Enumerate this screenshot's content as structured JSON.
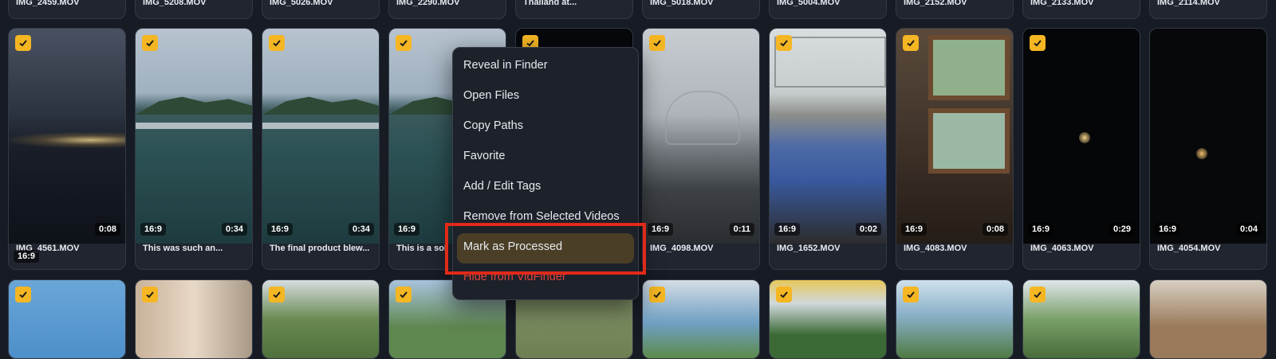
{
  "top_row_names": [
    "IMG_2459.MOV",
    "IMG_5208.MOV",
    "IMG_5026.MOV",
    "IMG_2290.MOV",
    "Thailand at...",
    "IMG_5018.MOV",
    "IMG_5004.MOV",
    "IMG_2152.MOV",
    "IMG_2133.MOV",
    "IMG_2114.MOV"
  ],
  "middle_row": [
    {
      "name": "IMG_4561.MOV",
      "aspect": "16:9",
      "duration": "0:08"
    },
    {
      "name": "This was such an...",
      "aspect": "16:9",
      "duration": "0:34"
    },
    {
      "name": "The final product blew...",
      "aspect": "16:9",
      "duration": "0:34"
    },
    {
      "name": "This is a sol",
      "aspect": "16:9",
      "duration": ""
    },
    {
      "name": "",
      "aspect": "",
      "duration": ""
    },
    {
      "name": "IMG_4098.MOV",
      "aspect": "16:9",
      "duration": "0:11"
    },
    {
      "name": "IMG_1652.MOV",
      "aspect": "16:9",
      "duration": "0:02"
    },
    {
      "name": "IMG_4083.MOV",
      "aspect": "16:9",
      "duration": "0:08"
    },
    {
      "name": "IMG_4063.MOV",
      "aspect": "16:9",
      "duration": "0:29"
    },
    {
      "name": "IMG_4054.MOV",
      "aspect": "16:9",
      "duration": "0:04"
    }
  ],
  "context_menu": {
    "items": [
      "Reveal in Finder",
      "Open Files",
      "Copy Paths",
      "Favorite",
      "Add / Edit Tags",
      "Remove from Selected Videos",
      "Mark as Processed",
      "Hide from VidFinder"
    ],
    "highlighted_index": 6,
    "danger_color": "#e0443a",
    "highlight_color": "#4a3f26"
  },
  "colors": {
    "checkbox": "#f5b623",
    "annotation_box": "#e02a1a",
    "background": "#171b24"
  }
}
